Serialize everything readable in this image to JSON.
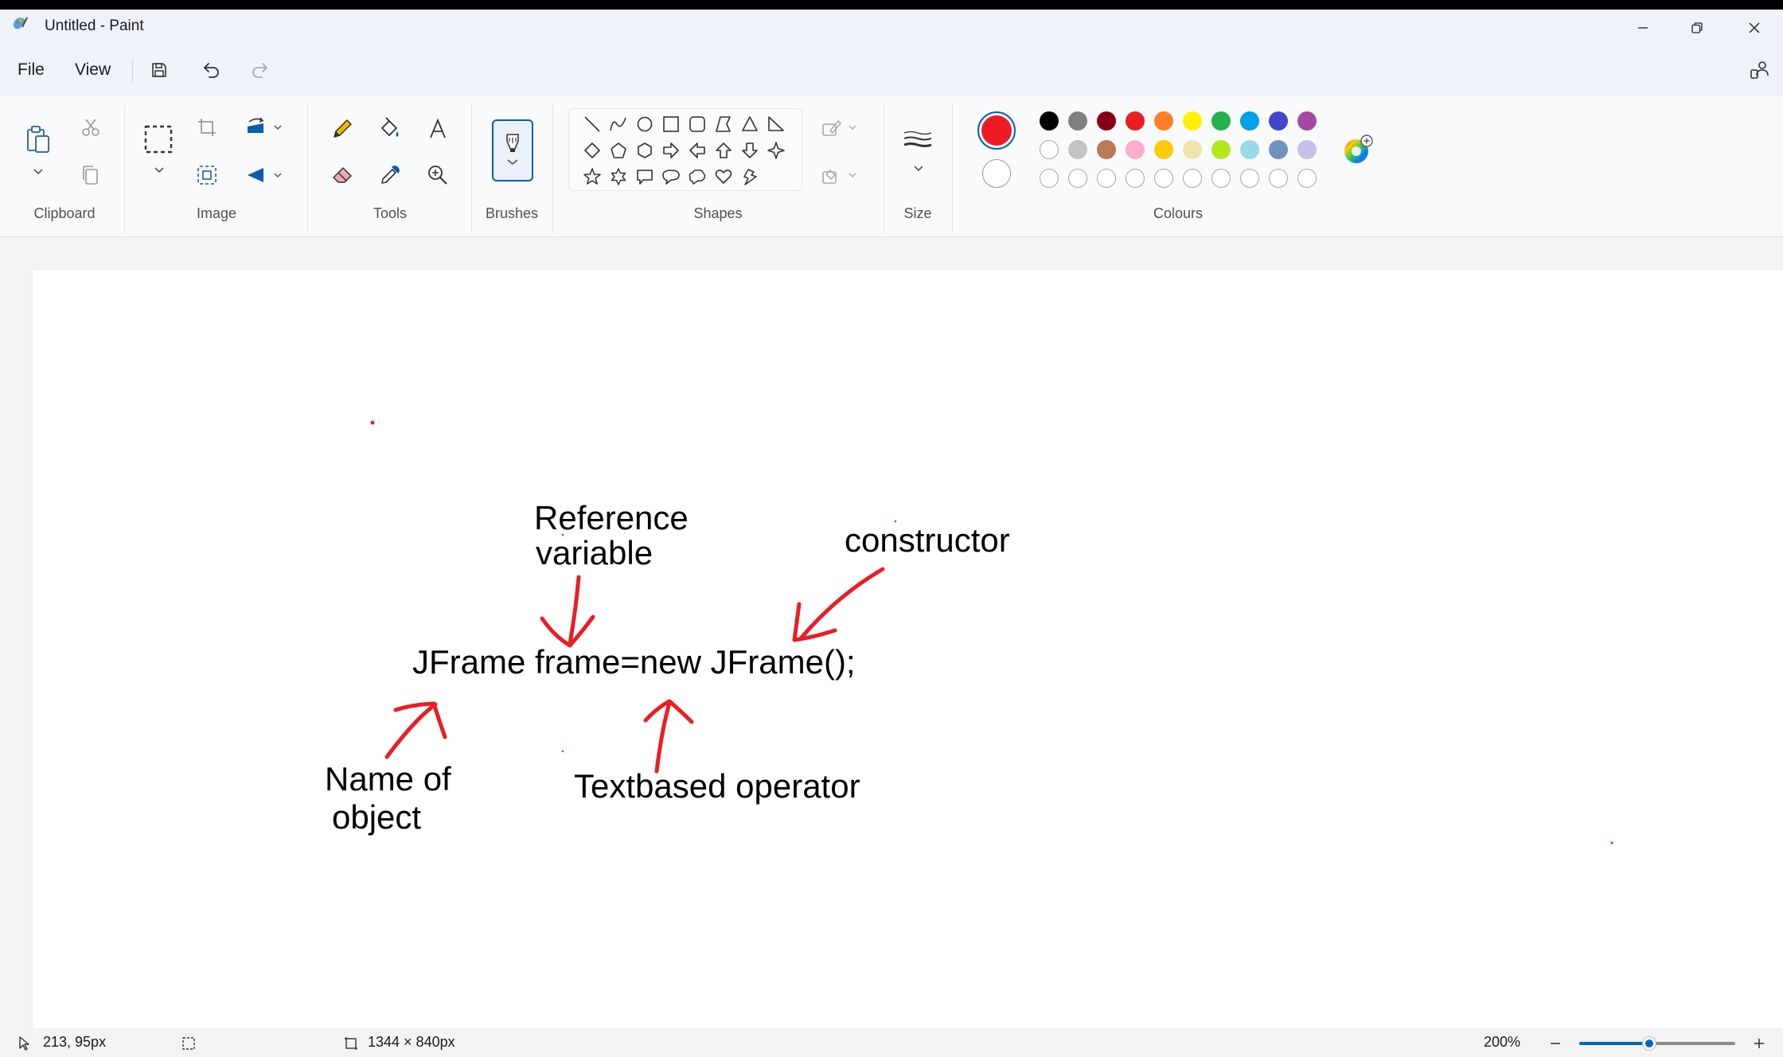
{
  "window": {
    "title": "Untitled - Paint"
  },
  "menu": {
    "file_label": "File",
    "view_label": "View"
  },
  "ribbon": {
    "groups": {
      "clipboard": "Clipboard",
      "image": "Image",
      "tools": "Tools",
      "brushes": "Brushes",
      "shapes": "Shapes",
      "size": "Size",
      "colours": "Colours"
    }
  },
  "colors": {
    "primary": "#ed1c24",
    "secondary": "#ffffff",
    "palette_row1": [
      "#000000",
      "#7f7f7f",
      "#880015",
      "#ed1c24",
      "#ff7f27",
      "#fff200",
      "#22b14c",
      "#00a2e8",
      "#3f48cc",
      "#a349a4"
    ],
    "palette_row2": [
      "#ffffff",
      "#c3c3c3",
      "#b97a57",
      "#ffaec9",
      "#ffc90e",
      "#efe4b0",
      "#b5e61d",
      "#99d9ea",
      "#7092be",
      "#c8bfe7"
    ],
    "palette_row3_empty_count": 10,
    "accent": "#0067c0"
  },
  "canvas": {
    "texts": {
      "reference_line1": "Reference",
      "reference_line2": "variable",
      "constructor": "constructor",
      "code": "JFrame frame=new JFrame();",
      "name_line1": "Name of",
      "name_line2": "object",
      "operator": "Textbased operator"
    },
    "annotation_color": "#ed1c24"
  },
  "status": {
    "cursor_position": "213, 95px",
    "canvas_size": "1344 × 840px",
    "zoom": "200%",
    "zoom_level": 0.45
  }
}
